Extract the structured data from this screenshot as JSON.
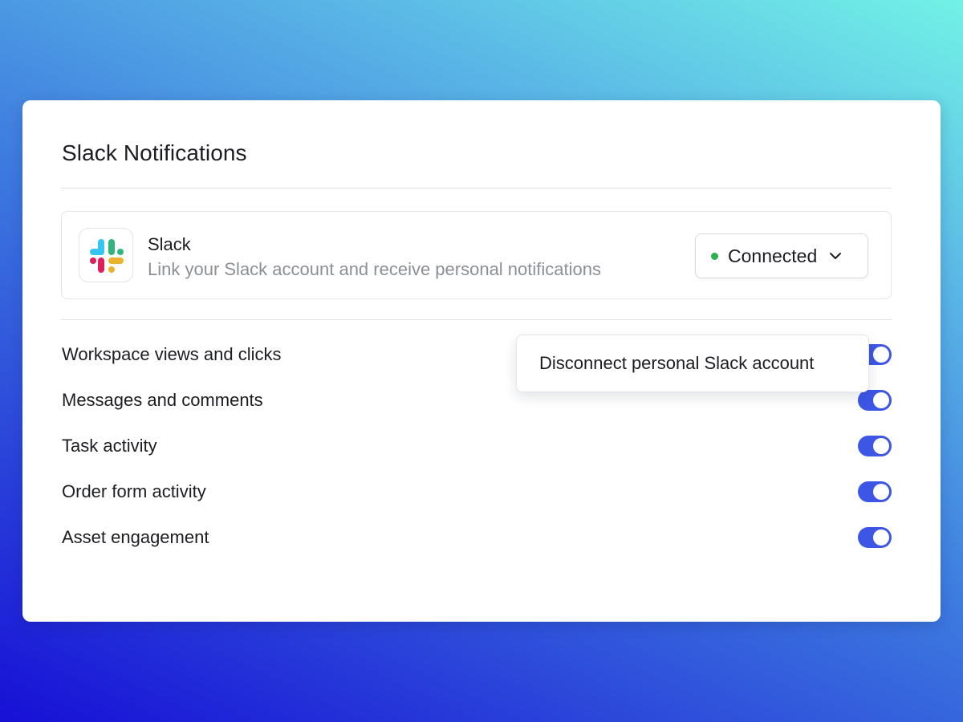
{
  "panel": {
    "title": "Slack Notifications"
  },
  "integration": {
    "icon": "slack-logo-icon",
    "name": "Slack",
    "description": "Link your Slack account and receive personal notifications",
    "status_label": "Connected",
    "status_color": "#2bb052",
    "dropdown_icon": "chevron-down-icon"
  },
  "dropdown_menu": {
    "items": [
      {
        "label": "Disconnect personal Slack account"
      }
    ]
  },
  "settings": [
    {
      "label": "Workspace views and clicks",
      "enabled": true
    },
    {
      "label": "Messages and comments",
      "enabled": true
    },
    {
      "label": "Task activity",
      "enabled": true
    },
    {
      "label": "Order form activity",
      "enabled": true
    },
    {
      "label": "Asset engagement",
      "enabled": true
    }
  ],
  "colors": {
    "toggle_on": "#3d56e6",
    "slack_blue": "#36c5f0",
    "slack_green": "#2eb67d",
    "slack_yellow": "#ecb22e",
    "slack_red": "#e01e5a"
  }
}
